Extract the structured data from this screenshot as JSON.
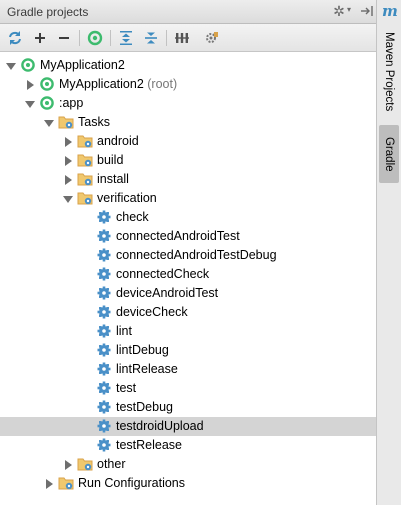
{
  "panel": {
    "title": "Gradle projects"
  },
  "sidebar": {
    "maven_letter": "m",
    "maven_label": "Maven Projects",
    "gradle_label": "Gradle"
  },
  "colors": {
    "selected_row": "#d4d4d4",
    "project_icon": "#3dbb6e",
    "task_gear": "#4a90c8",
    "folder": "#d8a24a",
    "toolbar_blue": "#3d8bbf"
  },
  "toolbar": {
    "refresh": "refresh-icon",
    "add": "add-icon",
    "remove": "remove-icon",
    "execute": "execute-task-icon",
    "expand_all": "expand-all-icon",
    "collapse_all": "collapse-all-icon",
    "toggle_offline": "toggle-offline-icon",
    "settings": "gradle-settings-icon"
  },
  "tree": [
    {
      "label": "MyApplication2",
      "suffix": "",
      "depth": 0,
      "arrow": "down",
      "icon": "gradle-project",
      "selected": false
    },
    {
      "label": "MyApplication2",
      "suffix": " (root)",
      "depth": 1,
      "arrow": "right",
      "icon": "gradle-project",
      "selected": false
    },
    {
      "label": ":app",
      "suffix": "",
      "depth": 1,
      "arrow": "down",
      "icon": "gradle-project",
      "selected": false
    },
    {
      "label": "Tasks",
      "suffix": "",
      "depth": 2,
      "arrow": "down",
      "icon": "task-folder",
      "selected": false
    },
    {
      "label": "android",
      "suffix": "",
      "depth": 3,
      "arrow": "right",
      "icon": "task-folder",
      "selected": false
    },
    {
      "label": "build",
      "suffix": "",
      "depth": 3,
      "arrow": "right",
      "icon": "task-folder",
      "selected": false
    },
    {
      "label": "install",
      "suffix": "",
      "depth": 3,
      "arrow": "right",
      "icon": "task-folder",
      "selected": false
    },
    {
      "label": "verification",
      "suffix": "",
      "depth": 3,
      "arrow": "down",
      "icon": "task-folder",
      "selected": false
    },
    {
      "label": "check",
      "suffix": "",
      "depth": 4,
      "arrow": "none",
      "icon": "task-gear",
      "selected": false
    },
    {
      "label": "connectedAndroidTest",
      "suffix": "",
      "depth": 4,
      "arrow": "none",
      "icon": "task-gear",
      "selected": false
    },
    {
      "label": "connectedAndroidTestDebug",
      "suffix": "",
      "depth": 4,
      "arrow": "none",
      "icon": "task-gear",
      "selected": false
    },
    {
      "label": "connectedCheck",
      "suffix": "",
      "depth": 4,
      "arrow": "none",
      "icon": "task-gear",
      "selected": false
    },
    {
      "label": "deviceAndroidTest",
      "suffix": "",
      "depth": 4,
      "arrow": "none",
      "icon": "task-gear",
      "selected": false
    },
    {
      "label": "deviceCheck",
      "suffix": "",
      "depth": 4,
      "arrow": "none",
      "icon": "task-gear",
      "selected": false
    },
    {
      "label": "lint",
      "suffix": "",
      "depth": 4,
      "arrow": "none",
      "icon": "task-gear",
      "selected": false
    },
    {
      "label": "lintDebug",
      "suffix": "",
      "depth": 4,
      "arrow": "none",
      "icon": "task-gear",
      "selected": false
    },
    {
      "label": "lintRelease",
      "suffix": "",
      "depth": 4,
      "arrow": "none",
      "icon": "task-gear",
      "selected": false
    },
    {
      "label": "test",
      "suffix": "",
      "depth": 4,
      "arrow": "none",
      "icon": "task-gear",
      "selected": false
    },
    {
      "label": "testDebug",
      "suffix": "",
      "depth": 4,
      "arrow": "none",
      "icon": "task-gear",
      "selected": false
    },
    {
      "label": "testdroidUpload",
      "suffix": "",
      "depth": 4,
      "arrow": "none",
      "icon": "task-gear",
      "selected": true
    },
    {
      "label": "testRelease",
      "suffix": "",
      "depth": 4,
      "arrow": "none",
      "icon": "task-gear",
      "selected": false
    },
    {
      "label": "other",
      "suffix": "",
      "depth": 3,
      "arrow": "right",
      "icon": "task-folder",
      "selected": false
    },
    {
      "label": "Run Configurations",
      "suffix": "",
      "depth": 2,
      "arrow": "right",
      "icon": "task-folder",
      "selected": false
    }
  ]
}
